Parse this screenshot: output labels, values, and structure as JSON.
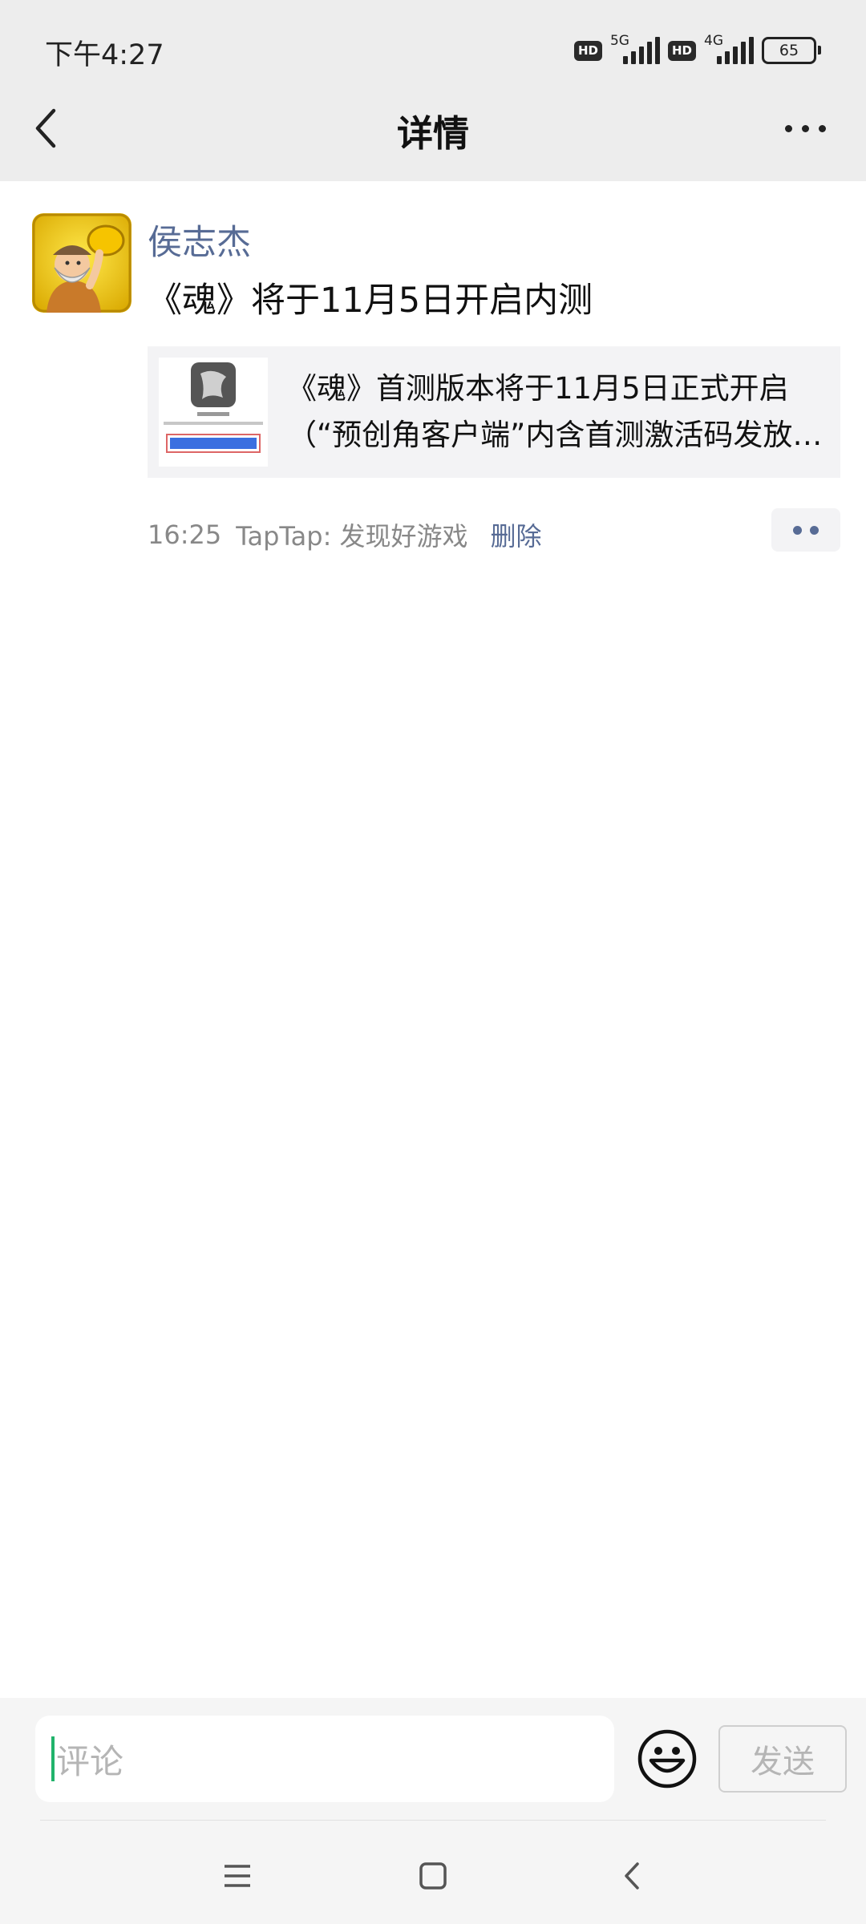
{
  "status_bar": {
    "time": "下午4:27",
    "hd1": "HD",
    "net1": "5G",
    "hd2": "HD",
    "net2": "4G",
    "battery": "65"
  },
  "header": {
    "title": "详情"
  },
  "post": {
    "author": "侯志杰",
    "text": "《魂》将于11月5日开启内测",
    "link_title": "《魂》首测版本将于11月5日正式开启（“预创角客户端”内含首测激活码发放…",
    "time": "16:25",
    "source": "TapTap: 发现好游戏",
    "delete_label": "删除"
  },
  "comment": {
    "placeholder": "评论",
    "send_label": "发送"
  },
  "colors": {
    "link_blue": "#576b95",
    "caret_green": "#21b36b",
    "header_bg": "#ededed"
  }
}
